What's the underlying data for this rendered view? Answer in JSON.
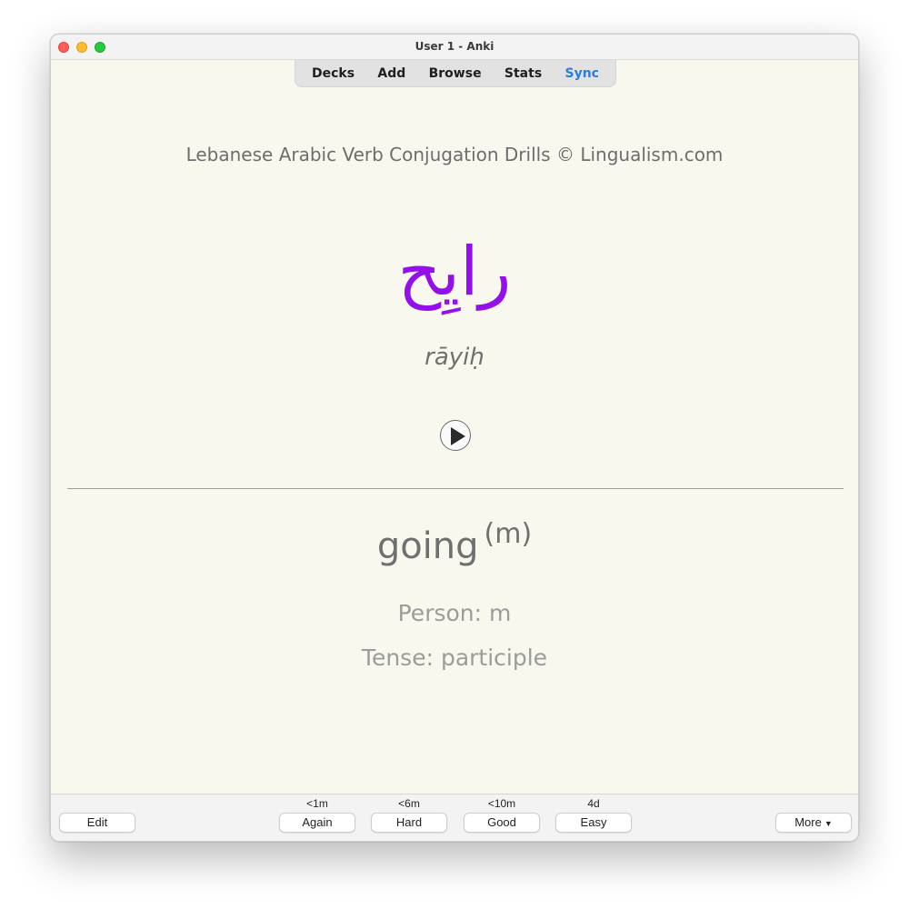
{
  "window": {
    "title": "User 1 - Anki"
  },
  "toolbar": {
    "items": [
      {
        "label": "Decks"
      },
      {
        "label": "Add"
      },
      {
        "label": "Browse"
      },
      {
        "label": "Stats"
      },
      {
        "label": "Sync"
      }
    ],
    "sync_color": "#2a7de1"
  },
  "card": {
    "deck_title": "Lebanese Arabic Verb Conjugation Drills © Lingualism.com",
    "arabic": "رايِح",
    "arabic_color": "#9410ea",
    "transliteration": "rāyiḥ",
    "play_icon": "play-icon",
    "meaning": "going",
    "meaning_suffix": "(m)",
    "person": "Person: m",
    "tense": "Tense: participle"
  },
  "bottombar": {
    "edit_label": "Edit",
    "more_label": "More",
    "answers": [
      {
        "label": "Again",
        "interval": "<1m"
      },
      {
        "label": "Hard",
        "interval": "<6m"
      },
      {
        "label": "Good",
        "interval": "<10m"
      },
      {
        "label": "Easy",
        "interval": "4d"
      }
    ]
  }
}
